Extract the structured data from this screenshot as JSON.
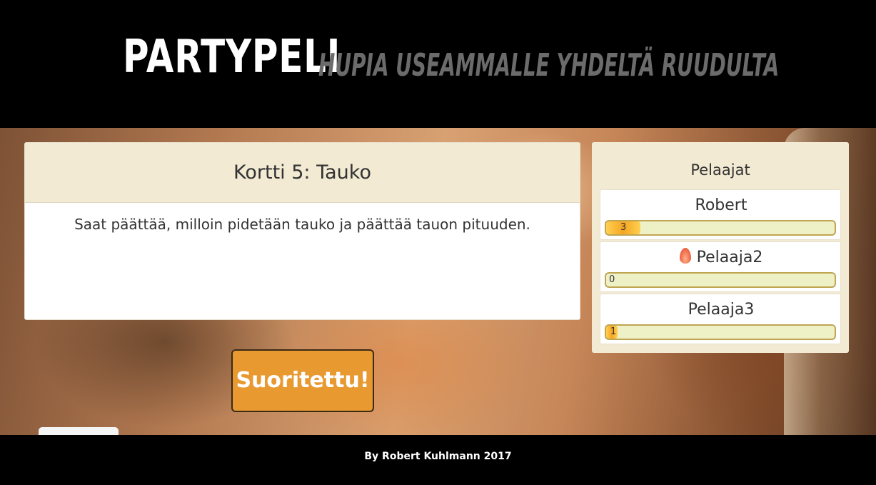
{
  "header": {
    "brand": "PARTYPELI",
    "tagline": "HUPIA USEAMMALLE YHDELTÄ RUUDULTA"
  },
  "card": {
    "title": "Kortti 5: Tauko",
    "text": "Saat päättää, milloin pidetään tauko ja päättää tauon pituuden."
  },
  "actions": {
    "done_label": "Suoritettu!"
  },
  "players": {
    "title": "Pelaajat",
    "list": [
      {
        "name": "Robert",
        "score": "3",
        "fill_pct": 15,
        "icon": ""
      },
      {
        "name": "Pelaaja2",
        "score": "0",
        "fill_pct": 0,
        "icon": "flame-icon"
      },
      {
        "name": "Pelaaja3",
        "score": "1",
        "fill_pct": 5,
        "icon": ""
      }
    ]
  },
  "footer": {
    "credit": "By Robert Kuhlmann 2017"
  }
}
